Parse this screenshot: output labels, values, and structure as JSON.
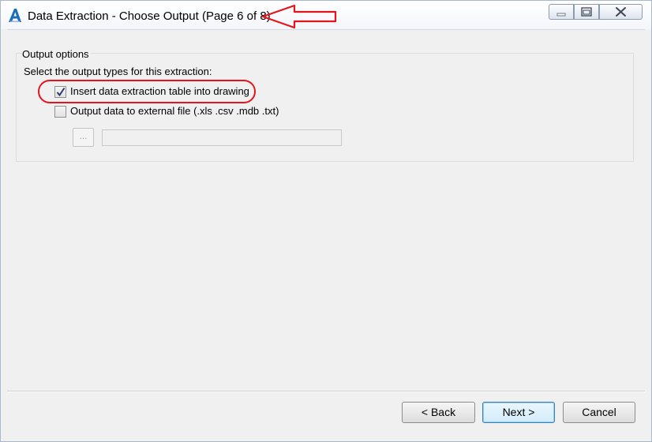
{
  "window": {
    "title": "Data Extraction - Choose Output (Page 6 of 8)",
    "icon": "autocad-a-icon"
  },
  "annotations": {
    "title_arrow_color": "#e4151d",
    "highlight_color": "#e4151d"
  },
  "group": {
    "title": "Output options",
    "prompt": "Select the output types for this extraction:",
    "options": [
      {
        "label": "Insert data extraction table into drawing",
        "checked": true
      },
      {
        "label": "Output data to external file (.xls .csv .mdb .txt)",
        "checked": false
      }
    ],
    "browse_label": "...",
    "file_path": ""
  },
  "buttons": {
    "back": "< Back",
    "next": "Next >",
    "cancel": "Cancel"
  }
}
